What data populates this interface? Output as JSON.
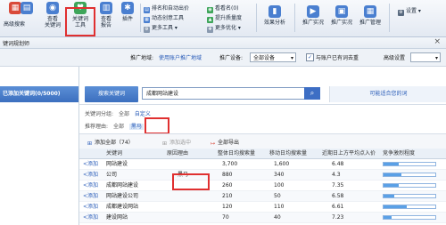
{
  "toolbar": {
    "buttons": [
      {
        "id": "b1",
        "label": "",
        "icon": "grid-icon",
        "color": "#d94a3a"
      },
      {
        "id": "b2",
        "label": "高级搜索",
        "icon": "search-doc-icon",
        "color": "#4a7fd0"
      },
      {
        "id": "b3",
        "label": "查看\n关键词",
        "icon": "view-icon",
        "color": "#4a7fd0"
      },
      {
        "id": "b4",
        "label": "关键词\n工具",
        "icon": "keyword-tool-icon",
        "color": "#3da55a"
      },
      {
        "id": "b5",
        "label": "查看\n报告",
        "icon": "report-icon",
        "color": "#4a7fd0"
      },
      {
        "id": "b6",
        "label": "插件",
        "icon": "plugin-icon",
        "color": "#4a7fd0"
      },
      {
        "id": "b7",
        "label": "效果分析",
        "icon": "analysis-icon",
        "color": "#4a7fd0"
      },
      {
        "id": "b8",
        "label": "推广实况",
        "icon": "live-icon",
        "color": "#4a7fd0"
      },
      {
        "id": "b9",
        "label": "推广实况",
        "icon": "tv-icon",
        "color": "#4a7fd0"
      },
      {
        "id": "b10",
        "label": "推广管理",
        "icon": "manage-icon",
        "color": "#4a7fd0"
      }
    ],
    "small_items": {
      "rank_bid": "排名和自动出价",
      "dynamic_creative": "动态创意工具",
      "more_tools": "更多工具",
      "view_ip": "看看名(0)",
      "improve_quality": "提升质量度",
      "more_optimize": "更多优化"
    },
    "settings_label": "设置"
  },
  "window": {
    "title": "键词规划师"
  },
  "settings_row": {
    "area_label": "推广地域:",
    "area_value": "使用账户推广地域",
    "device_label": "推广设备:",
    "device_value": "全部设备",
    "same_account_label": "与账户已有词去重",
    "advanced_label": "高级设置"
  },
  "left_panel": {
    "header": "已添加关键词(0/5000)"
  },
  "search": {
    "tab_label": "搜索关键词",
    "query": "成都网站建设",
    "recommend_link": "可能适合您的词"
  },
  "filters": {
    "group_label": "关键词分组:",
    "group_all": "全部",
    "group_custom": "自定义",
    "reason_label": "推荐理由:",
    "reason_all": "全部",
    "reason_selected": "黑马"
  },
  "actions": {
    "add_all": "添加全部（74）",
    "add_selected": "添加选中",
    "export_all": "全部导出"
  },
  "table": {
    "columns": [
      "关键词",
      "原因理由",
      "整体日均搜索量",
      "移动日均搜索量",
      "近期日上方平均点入价",
      "竞争激烈程度"
    ],
    "rows": [
      {
        "add": "<添加",
        "keyword": "网站建设",
        "reason": "",
        "total": "3,700",
        "mobile": "1,600",
        "price": "6.48",
        "competition": 0.3
      },
      {
        "add": "<添加",
        "keyword": "公司",
        "reason": "黑马",
        "total": "880",
        "mobile": "340",
        "price": "4.3",
        "competition": 0.35
      },
      {
        "add": "<添加",
        "keyword": "成都网站建设",
        "reason": "",
        "total": "260",
        "mobile": "100",
        "price": "7.35",
        "competition": 0.3
      },
      {
        "add": "<添加",
        "keyword": "网站建设公司",
        "reason": "",
        "total": "210",
        "mobile": "50",
        "price": "6.58",
        "competition": 0.2
      },
      {
        "add": "<添加",
        "keyword": "成都建设网站",
        "reason": "",
        "total": "120",
        "mobile": "110",
        "price": "6.61",
        "competition": 0.45
      },
      {
        "add": "<添加",
        "keyword": "建设网站",
        "reason": "",
        "total": "70",
        "mobile": "40",
        "price": "7.23",
        "competition": 0.15
      }
    ]
  }
}
